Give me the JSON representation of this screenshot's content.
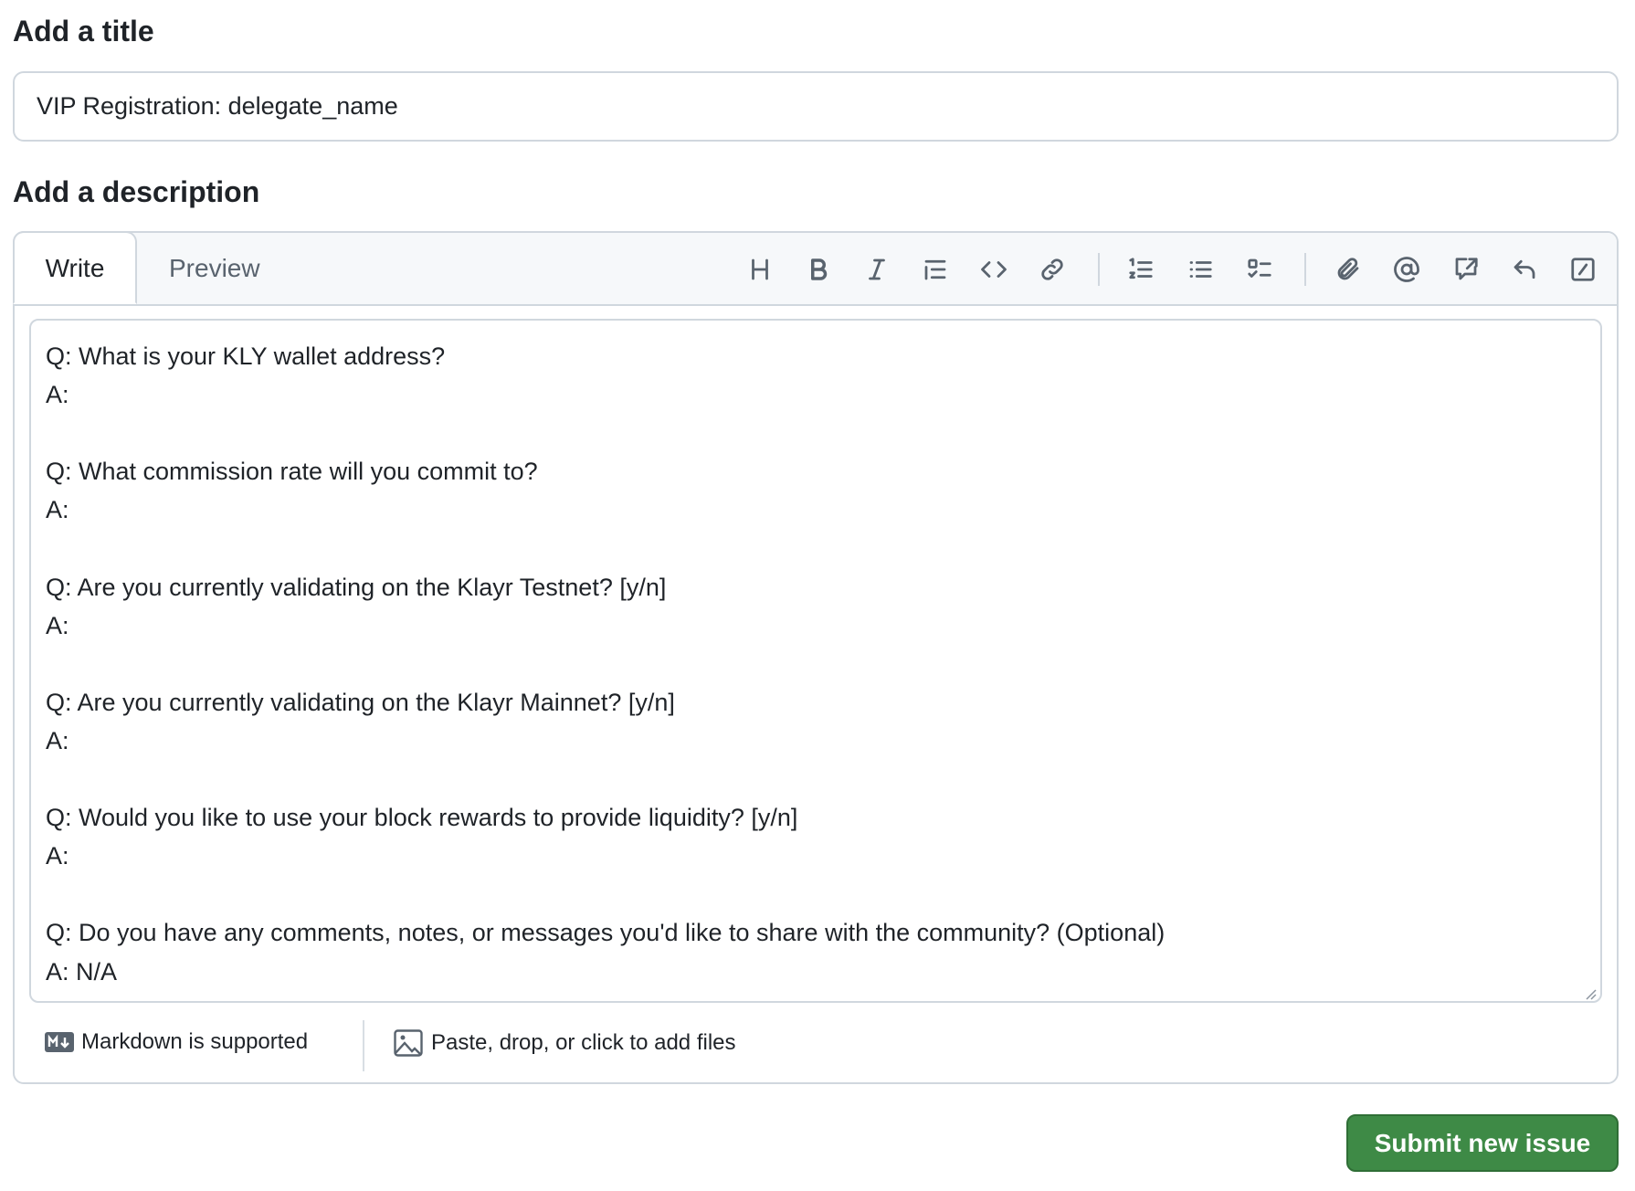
{
  "title_section": {
    "heading": "Add a title",
    "value": "VIP Registration: delegate_name"
  },
  "description_section": {
    "heading": "Add a description",
    "tabs": [
      {
        "label": "Write",
        "active": true
      },
      {
        "label": "Preview",
        "active": false
      }
    ],
    "toolbar": [
      "heading-icon",
      "bold-icon",
      "italic-icon",
      "quote-icon",
      "code-icon",
      "link-icon",
      "ordered-list-icon",
      "unordered-list-icon",
      "task-list-icon",
      "attach-icon",
      "mention-icon",
      "cross-reference-icon",
      "reply-icon",
      "slash-command-icon"
    ],
    "body": "Q: What is your KLY wallet address?\nA:\n\nQ: What commission rate will you commit to?\nA:\n\nQ: Are you currently validating on the Klayr Testnet? [y/n]\nA:\n\nQ: Are you currently validating on the Klayr Mainnet? [y/n]\nA:\n\nQ: Would you like to use your block rewards to provide liquidity? [y/n]\nA:\n\nQ: Do you have any comments, notes, or messages you'd like to share with the community? (Optional)\nA: N/A",
    "footer": {
      "markdown_label": "Markdown is supported",
      "files_label": "Paste, drop, or click to add files"
    }
  },
  "submit_label": "Submit new issue",
  "colors": {
    "submit": "#3e8a46",
    "border": "#d0d7de",
    "toolbar_bg": "#f6f8fa"
  }
}
